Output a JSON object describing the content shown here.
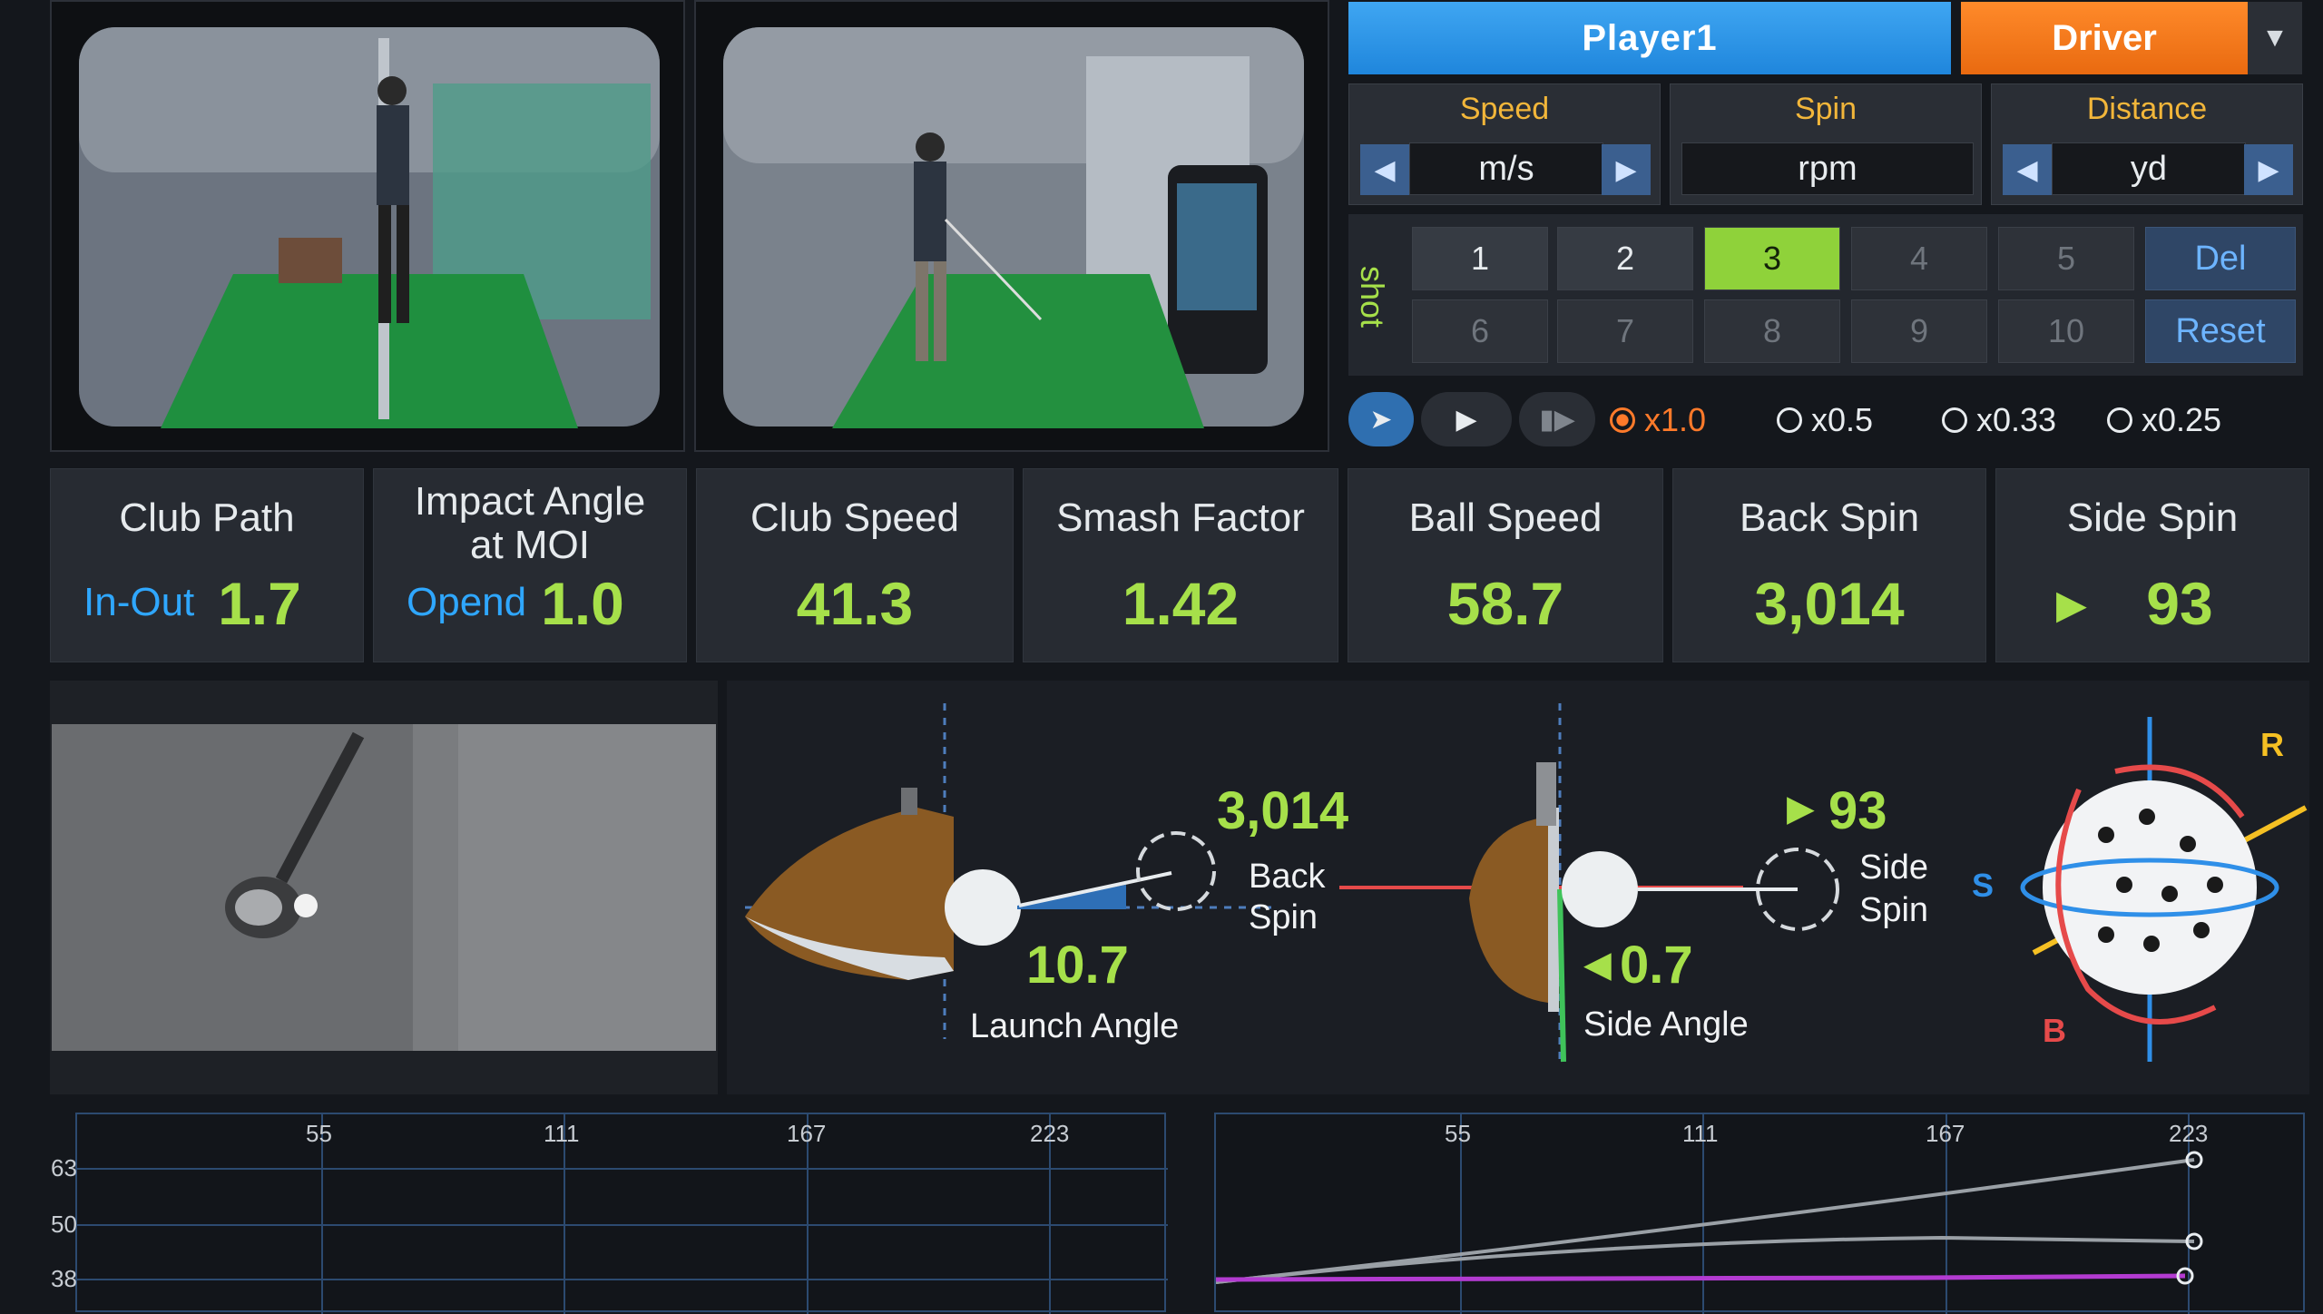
{
  "header": {
    "player_label": "Player1",
    "club_label": "Driver",
    "dropdown_icon": "chevron-down-icon"
  },
  "units": [
    {
      "title": "Speed",
      "value": "m/s"
    },
    {
      "title": "Spin",
      "value": "rpm"
    },
    {
      "title": "Distance",
      "value": "yd"
    }
  ],
  "shots": {
    "label": "shot",
    "row1": [
      "1",
      "2",
      "3",
      "4",
      "5"
    ],
    "row2": [
      "6",
      "7",
      "8",
      "9",
      "10"
    ],
    "delete_label": "Del",
    "reset_label": "Reset",
    "selected": "3"
  },
  "playback": {
    "speeds": [
      "x1.0",
      "x0.5",
      "x0.33",
      "x0.25"
    ],
    "selected": "x1.0"
  },
  "metrics": {
    "club_path": {
      "label": "Club Path",
      "sub": "In-Out",
      "value": "1.7"
    },
    "impact_angle": {
      "label_line1": "Impact Angle",
      "label_line2": "at MOI",
      "sub": "Opend",
      "value": "1.0"
    },
    "club_speed": {
      "label": "Club Speed",
      "value": "41.3"
    },
    "smash_factor": {
      "label": "Smash Factor",
      "value": "1.42"
    },
    "ball_speed": {
      "label": "Ball Speed",
      "value": "58.7"
    },
    "back_spin": {
      "label": "Back Spin",
      "value": "3,014"
    },
    "side_spin": {
      "label": "Side Spin",
      "value": "93",
      "arrow": "▶"
    }
  },
  "diagram": {
    "back_spin_value": "3,014",
    "back_spin_l1": "Back",
    "back_spin_l2": "Spin",
    "launch_angle_value": "10.7",
    "launch_angle_label": "Launch Angle",
    "side_spin_value": "93",
    "side_spin_arrow": "▶",
    "side_spin_l1": "Side",
    "side_spin_l2": "Spin",
    "side_angle_value": "0.7",
    "side_angle_arrow": "◀",
    "side_angle_label": "Side Angle",
    "axis_r": "R",
    "axis_s": "S",
    "axis_b": "B"
  },
  "graphs": {
    "left": {
      "x_ticks": [
        "55",
        "111",
        "167",
        "223"
      ],
      "y_ticks": [
        "63",
        "50",
        "38"
      ]
    },
    "right": {
      "x_ticks": [
        "55",
        "111",
        "167",
        "223"
      ]
    }
  }
}
